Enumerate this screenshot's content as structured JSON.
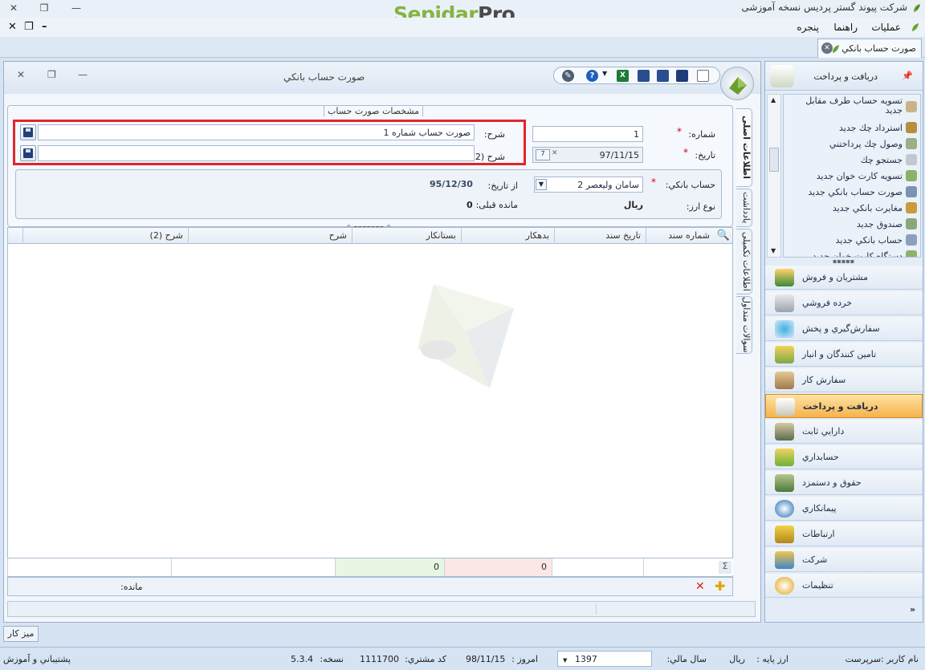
{
  "app": {
    "brand_part1": "Sepidar",
    "brand_part2": "Pro",
    "company_title": "شرکت پیوند گستر پردیس نسخه آموزشی"
  },
  "menu": [
    "عملیات",
    "راهنما",
    "پنجره"
  ],
  "doc_tab": {
    "label": "صورت حساب بانكي"
  },
  "window": {
    "title": "صورت حساب بانكي"
  },
  "form": {
    "legend": "مشخصات صورت حساب",
    "number_label": "شماره:",
    "number_value": "1",
    "date_label": "تاریخ:",
    "date_value": "97/11/15",
    "desc_label": "شرح:",
    "desc_value": "صورت حساب شماره 1",
    "desc2_label": "شرح (2):",
    "desc2_value": "",
    "bank_label": "حساب بانكي:",
    "bank_value": "سامان وليعصر 2",
    "from_date_label": "از تاریخ:",
    "from_date_value": "95/12/30",
    "currency_label": "نوع ارز:",
    "currency_value": "ریال",
    "prev_balance_label": "مانده قبلی:",
    "prev_balance_value": "0"
  },
  "grid": {
    "columns": [
      "شماره سند",
      "تاريخ سند",
      "بدهكار",
      "بستانكار",
      "شرح",
      "شرح (2)"
    ],
    "totals": {
      "debit": "0",
      "credit": "0"
    },
    "footer_label": "مانده:"
  },
  "side_tabs": [
    "اطلاعات اصلی",
    "يادداشت",
    "اطلاعات تكميلی",
    "سوالات متداول"
  ],
  "right_panel": {
    "title": "دریافت و پرداخت",
    "items": [
      "تسويه حساب طرف مقابل جديد",
      "استرداد چك جديد",
      "وصول چك پرداختني",
      "جستجو چك",
      "تسويه كارت خوان جديد",
      "صورت حساب بانكي جديد",
      "مغايرت بانكي جديد",
      "صندوق جديد",
      "حساب بانكي جديد",
      "دستگاه كارت خوان جديد"
    ],
    "modules": [
      "مشتريان و فروش",
      "خرده فروشي",
      "سفارش‌گيري و پخش",
      "تامين كنندگان و انبار",
      "سفارش كار",
      "دريافت و پرداخت",
      "دارايي ثابت",
      "حسابداري",
      "حقوق و دستمزد",
      "پيمانكاري",
      "ارتباطات",
      "شركت",
      "تنظيمات"
    ],
    "active_module": "دريافت و پرداخت"
  },
  "bottom": {
    "desk_label": "ميز كار",
    "user_label": "نام كاربر :سرپرست",
    "base_currency_label": "ارز پايه :",
    "base_currency_value": "ريال",
    "fiscal_year_label": "سال مالي:",
    "fiscal_year_value": "1397",
    "today_label": "امروز :",
    "today_value": "98/11/15",
    "customer_code_label": "كد مشتري:",
    "customer_code_value": "1111700",
    "version_label": "نسخه:",
    "version_value": "5.3.4",
    "support_label": "پشتيباني و آموزش"
  }
}
